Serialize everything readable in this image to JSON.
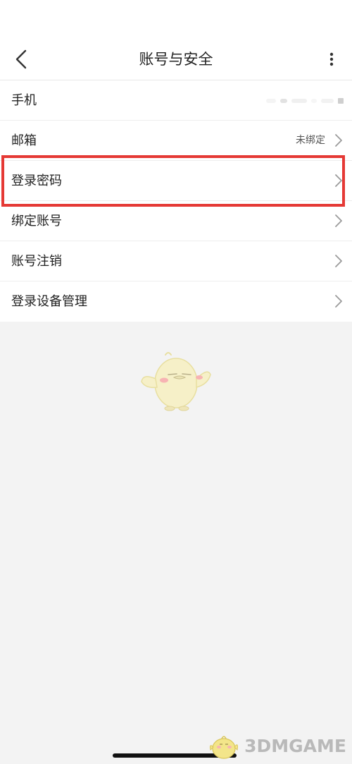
{
  "header": {
    "title": "账号与安全",
    "back_icon": "chevron-left-icon",
    "more_icon": "more-vertical-icon"
  },
  "settings": {
    "items": [
      {
        "label": "手机",
        "value": "",
        "value_hidden": true
      },
      {
        "label": "邮箱",
        "value": "未绑定"
      },
      {
        "label": "登录密码",
        "value": ""
      },
      {
        "label": "绑定账号",
        "value": ""
      },
      {
        "label": "账号注销",
        "value": ""
      },
      {
        "label": "登录设备管理",
        "value": ""
      }
    ],
    "highlighted_item": "登录密码"
  },
  "watermark": {
    "text": "3DMGAME"
  },
  "colors": {
    "highlight": "#e53935",
    "background": "#f3f3f3",
    "surface": "#ffffff",
    "mascot_body": "#f6f0c8"
  }
}
